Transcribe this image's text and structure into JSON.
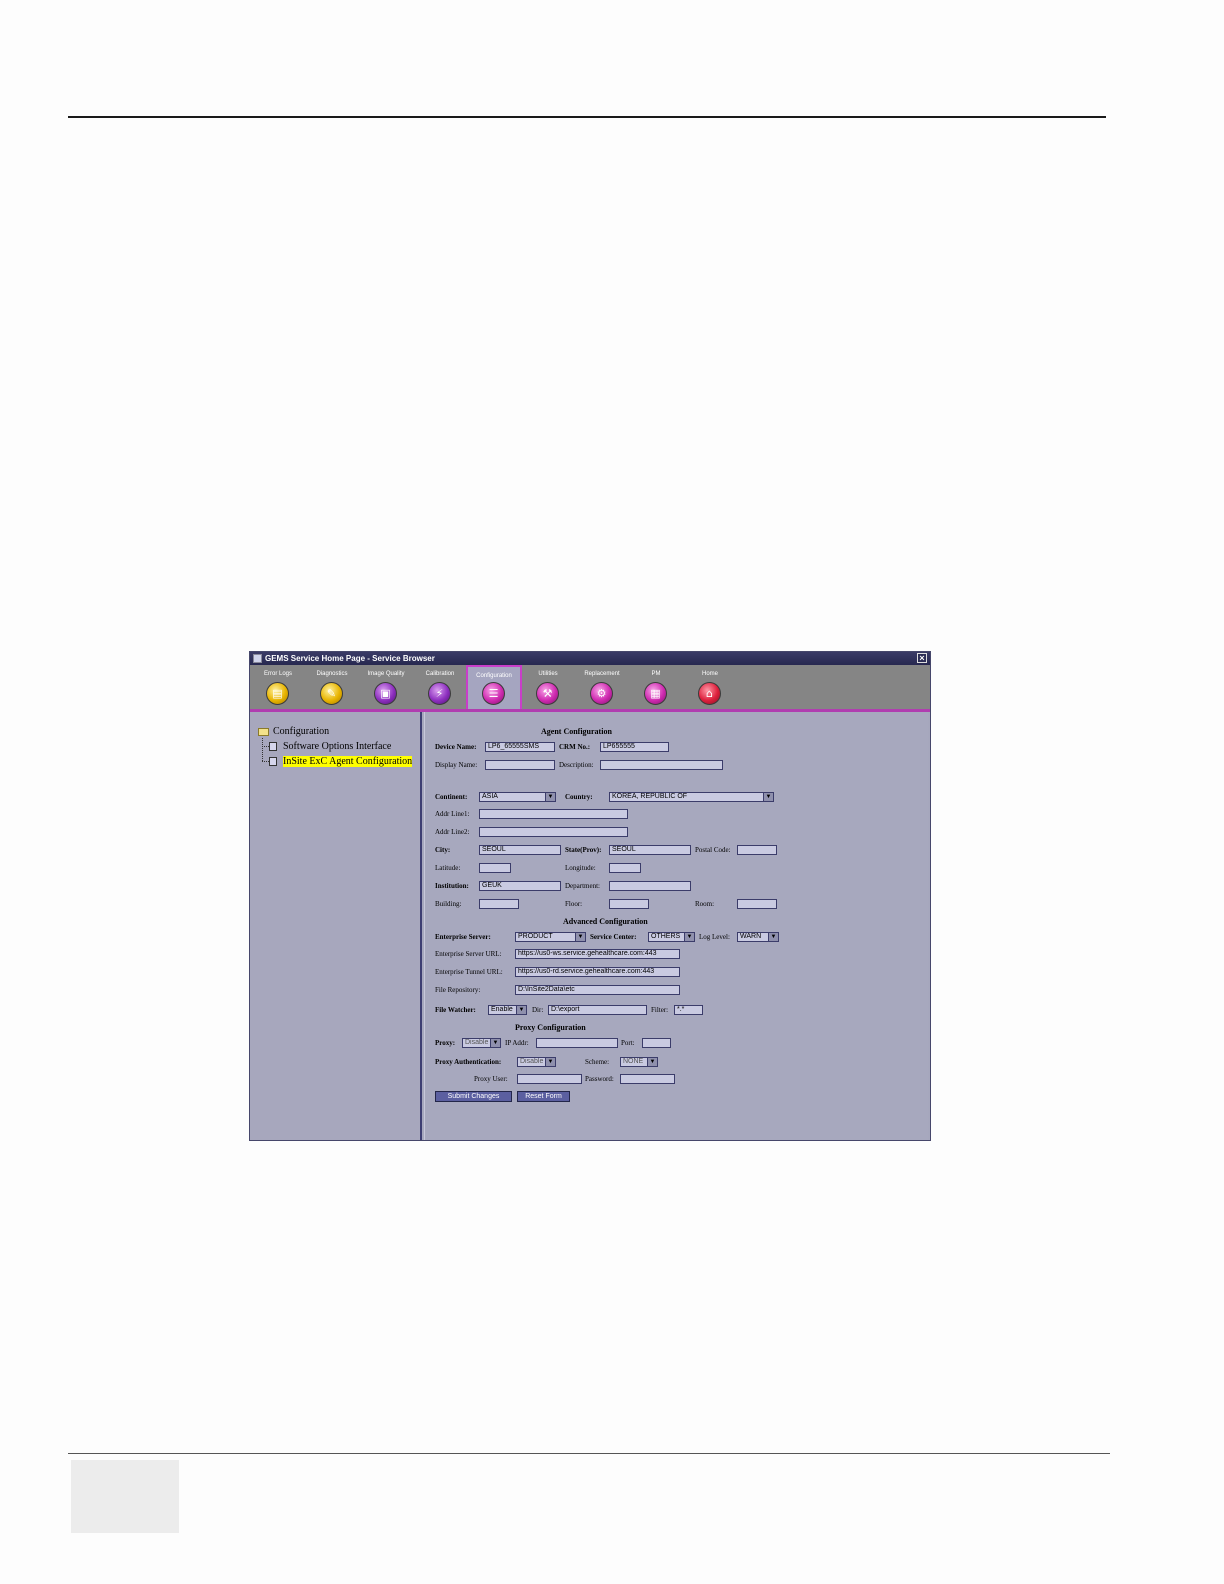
{
  "window": {
    "title": "GEMS Service Home Page - Service Browser",
    "close_glyph": "×"
  },
  "toolbar": {
    "items": [
      {
        "label": "Error Logs",
        "icon": "error-logs-icon",
        "glyph": "▤",
        "color": "yellow"
      },
      {
        "label": "Diagnostics",
        "icon": "diagnostics-icon",
        "glyph": "✎",
        "color": "yellow"
      },
      {
        "label": "Image Quality",
        "icon": "image-quality-icon",
        "glyph": "▣",
        "color": "purple"
      },
      {
        "label": "Calibration",
        "icon": "calibration-icon",
        "glyph": "⚡",
        "color": "purple"
      },
      {
        "label": "Configuration",
        "icon": "configuration-icon",
        "glyph": "☰",
        "color": "magenta",
        "active": true
      },
      {
        "label": "Utilities",
        "icon": "utilities-icon",
        "glyph": "⚒",
        "color": "magenta"
      },
      {
        "label": "Replacement",
        "icon": "replacement-icon",
        "glyph": "⚙",
        "color": "magenta"
      },
      {
        "label": "PM",
        "icon": "pm-icon",
        "glyph": "▦",
        "color": "magenta"
      },
      {
        "label": "Home",
        "icon": "home-icon",
        "glyph": "⌂",
        "color": "red"
      }
    ]
  },
  "tree": {
    "root": "Configuration",
    "items": [
      "Software Options Interface",
      "InSite ExC Agent Configuration"
    ]
  },
  "form": {
    "agent_title": "Agent Configuration",
    "device_name_label": "Device Name:",
    "device_name": "LP6_65555SMS",
    "crm_label": "CRM No.:",
    "crm": "LP655555",
    "display_name_label": "Display Name:",
    "display_name": "",
    "description_label": "Description:",
    "description": "",
    "continent_label": "Continent:",
    "continent": "ASIA",
    "country_label": "Country:",
    "country": "KOREA, REPUBLIC OF",
    "addr1_label": "Addr Line1:",
    "addr1": "",
    "addr2_label": "Addr Line2:",
    "addr2": "",
    "city_label": "City:",
    "city": "SEOUL",
    "state_label": "State(Prov):",
    "state": "SEOUL",
    "postal_label": "Postal Code:",
    "postal": "",
    "latitude_label": "Latitude:",
    "latitude": "",
    "longitude_label": "Longitude:",
    "longitude": "",
    "institution_label": "Institution:",
    "institution": "GEUK",
    "department_label": "Department:",
    "department": "",
    "building_label": "Building:",
    "building": "",
    "floor_label": "Floor:",
    "floor": "",
    "room_label": "Room:",
    "room": "",
    "advanced_title": "Advanced Configuration",
    "ent_server_label": "Enterprise Server:",
    "ent_server": "PRODUCT",
    "service_center_label": "Service Center:",
    "service_center": "OTHERS",
    "log_level_label": "Log Level:",
    "log_level": "WARN",
    "ent_url_label": "Enterprise Server URL:",
    "ent_url": "https://us0-ws.service.gehealthcare.com:443",
    "tunnel_url_label": "Enterprise Tunnel URL:",
    "tunnel_url": "https://us0-rd.service.gehealthcare.com:443",
    "file_repo_label": "File Repository:",
    "file_repo": "D:\\InSite2Data\\etc",
    "file_watcher_label": "File Watcher:",
    "file_watcher": "Enable",
    "dir_label": "Dir:",
    "dir": "D:\\export",
    "filter_label": "Filter:",
    "filter": "*.*",
    "proxy_title": "Proxy Configuration",
    "proxy_label": "Proxy:",
    "proxy": "Disable",
    "ip_label": "IP Addr:",
    "ip": "",
    "port_label": "Port:",
    "port": "",
    "proxy_auth_label": "Proxy Authentication:",
    "proxy_auth": "Disable",
    "scheme_label": "Scheme:",
    "scheme": "NONE",
    "proxy_user_label": "Proxy User:",
    "proxy_user": "",
    "password_label": "Password:",
    "password": "",
    "submit_label": "Submit Changes",
    "reset_label": "Reset Form"
  }
}
